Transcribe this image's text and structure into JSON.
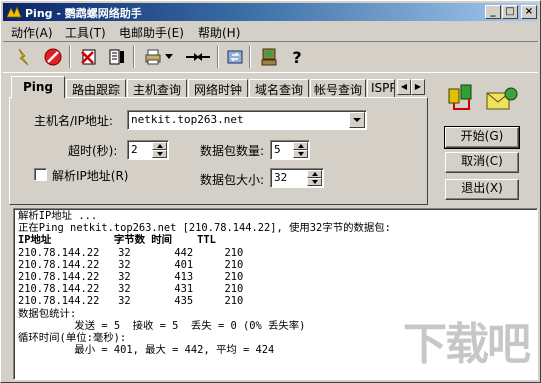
{
  "window": {
    "title": "Ping - 鹦鹉螺网络助手",
    "min_label": "_",
    "max_label": "□",
    "close_label": "×"
  },
  "menu": {
    "items": [
      {
        "label": "动作(A)"
      },
      {
        "label": "工具(T)"
      },
      {
        "label": "电邮助手(E)"
      },
      {
        "label": "帮助(H)"
      }
    ]
  },
  "toolbar": {
    "icons": [
      "lightning-icon",
      "stop-icon",
      "delete-list-icon",
      "save-list-icon",
      "print-icon",
      "dropdown-arrow-icon",
      "connect-icon",
      "refresh-icon",
      "network-icon",
      "help-icon"
    ]
  },
  "tabs": [
    {
      "label": "Ping",
      "active": true
    },
    {
      "label": "路由跟踪"
    },
    {
      "label": "主机查询"
    },
    {
      "label": "网络时钟"
    },
    {
      "label": "域名查询"
    },
    {
      "label": "帐号查询"
    },
    {
      "label": "ISPP"
    }
  ],
  "form": {
    "host_label": "主机名/IP地址:",
    "host_value": "netkit.top263.net",
    "timeout_label": "超时(秒):",
    "timeout_value": "2",
    "packet_count_label": "数据包数量:",
    "packet_count_value": "5",
    "resolve_label": "解析IP地址(R)",
    "resolve_checked": false,
    "packet_size_label": "数据包大小:",
    "packet_size_value": "32"
  },
  "buttons": {
    "start": "开始(G)",
    "cancel": "取消(C)",
    "exit": "退出(X)"
  },
  "output": {
    "lines": [
      "解析IP地址 ...",
      "正在Ping netkit.top263.net [210.78.144.22], 使用32字节的数据包:",
      "IP地址          字节数 时间    TTL",
      "210.78.144.22   32       442     210",
      "210.78.144.22   32       401     210",
      "210.78.144.22   32       413     210",
      "210.78.144.22   32       431     210",
      "210.78.144.22   32       435     210",
      "数据包统计:",
      "         发送 = 5  接收 = 5  丢失 = 0 (0% 丢失率)",
      "循环时间(单位:毫秒):",
      "         最小 = 401, 最大 = 442, 平均 = 424"
    ]
  },
  "watermark": {
    "text": "下载吧"
  }
}
